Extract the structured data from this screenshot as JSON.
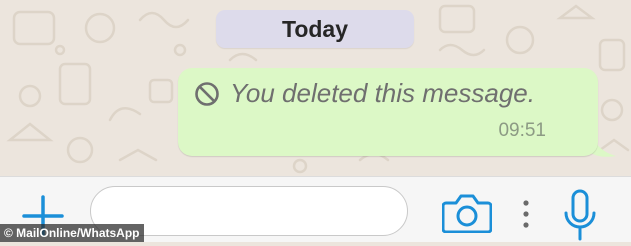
{
  "colors": {
    "wallpaper": "#ece5dd",
    "bubble_outgoing": "#dcf8c6",
    "date_pill": "#dddbeb",
    "accent": "#1b8fd8",
    "input_bar": "#f6f6f6"
  },
  "chat": {
    "date_separator": "Today",
    "messages": [
      {
        "direction": "outgoing",
        "icon": "block-icon",
        "text": "You deleted this message.",
        "time": "09:51"
      }
    ]
  },
  "input_bar": {
    "icons": [
      "plus-icon",
      "camera-icon",
      "more-dots-icon",
      "microphone-icon"
    ],
    "message_value": ""
  },
  "watermark": {
    "text": "© MailOnline/WhatsApp"
  }
}
